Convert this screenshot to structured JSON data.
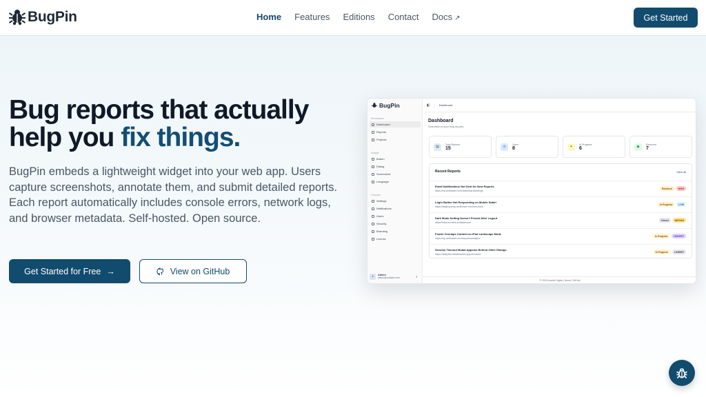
{
  "nav": {
    "brand": "BugPin",
    "links": [
      "Home",
      "Features",
      "Editions",
      "Contact",
      "Docs"
    ],
    "cta": "Get Started"
  },
  "hero": {
    "title_line1": "Bug reports that actually",
    "title_line2_plain": "help you ",
    "title_line2_accent": "fix things.",
    "description": "BugPin embeds a lightweight widget into your web app. Users capture screenshots, annotate them, and submit detailed reports. Each report automatically includes console errors, network logs, and browser metadata. Self-hosted. Open source.",
    "primary_cta": "Get Started for Free",
    "secondary_cta": "View on GitHub"
  },
  "preview": {
    "brand": "BugPin",
    "breadcrumb": "Dashboard",
    "sidebar": {
      "group_workspace": "Workspace",
      "workspace_items": [
        "Dashboard",
        "Reports",
        "Projects"
      ],
      "group_widget": "Widget",
      "widget_items": [
        "Button",
        "Dialog",
        "Screenshot",
        "Language"
      ],
      "group_console": "Console",
      "console_items": [
        "Settings",
        "Notifications",
        "Users",
        "Security",
        "Branding",
        "License"
      ],
      "user_name": "Admin",
      "user_email": "admin@example.com"
    },
    "page_title": "Dashboard",
    "page_subtitle": "Overview of your bug reports",
    "stats": [
      {
        "label": "Total Reports",
        "value": "15"
      },
      {
        "label": "Open",
        "value": "8"
      },
      {
        "label": "In Progress",
        "value": "6"
      },
      {
        "label": "Resolved",
        "value": "7"
      }
    ],
    "recent_title": "Recent Reports",
    "view_all": "View all",
    "reports": [
      {
        "title": "Email Notifications Not Sent for New Reports",
        "url": "https://my.arnthware.com/dashboard/settings",
        "tags": [
          "Resolved",
          "HIGH"
        ]
      },
      {
        "title": "Login Button Not Responding on Mobile Safari",
        "url": "https://staging.shop.arnthware.com/checkout",
        "tags": [
          "In Progress",
          "LOW"
        ]
      },
      {
        "title": "Dark Mode Setting Doesn't Persist After Logout",
        "url": "https://beta.techflow.io/dashboard",
        "tags": [
          "Closed",
          "MEDIUM"
        ]
      },
      {
        "title": "Footer Overlaps Content on iPad Landscape Mode",
        "url": "https://my.arnthware.com/reports/analytics",
        "tags": [
          "In Progress",
          "HIGHEST"
        ]
      },
      {
        "title": "Session Timeout Modal Appears Behind Other Dialogs",
        "url": "https://analytics.dataflowweb.app/checkout",
        "tags": [
          "In Progress",
          "LOWEST"
        ]
      }
    ],
    "footer": "© 2026 Arantic Digital | About | GitHub"
  },
  "colors": {
    "brand": "#114b6e",
    "accent_text": "#134e74",
    "tag_resolved": "#fef3c7",
    "tag_high": "#fecaca",
    "tag_low": "#e0f2fe",
    "tag_medium": "#fde68a",
    "tag_highest": "#ddd6fe",
    "tag_lowest": "#e5e7eb"
  }
}
